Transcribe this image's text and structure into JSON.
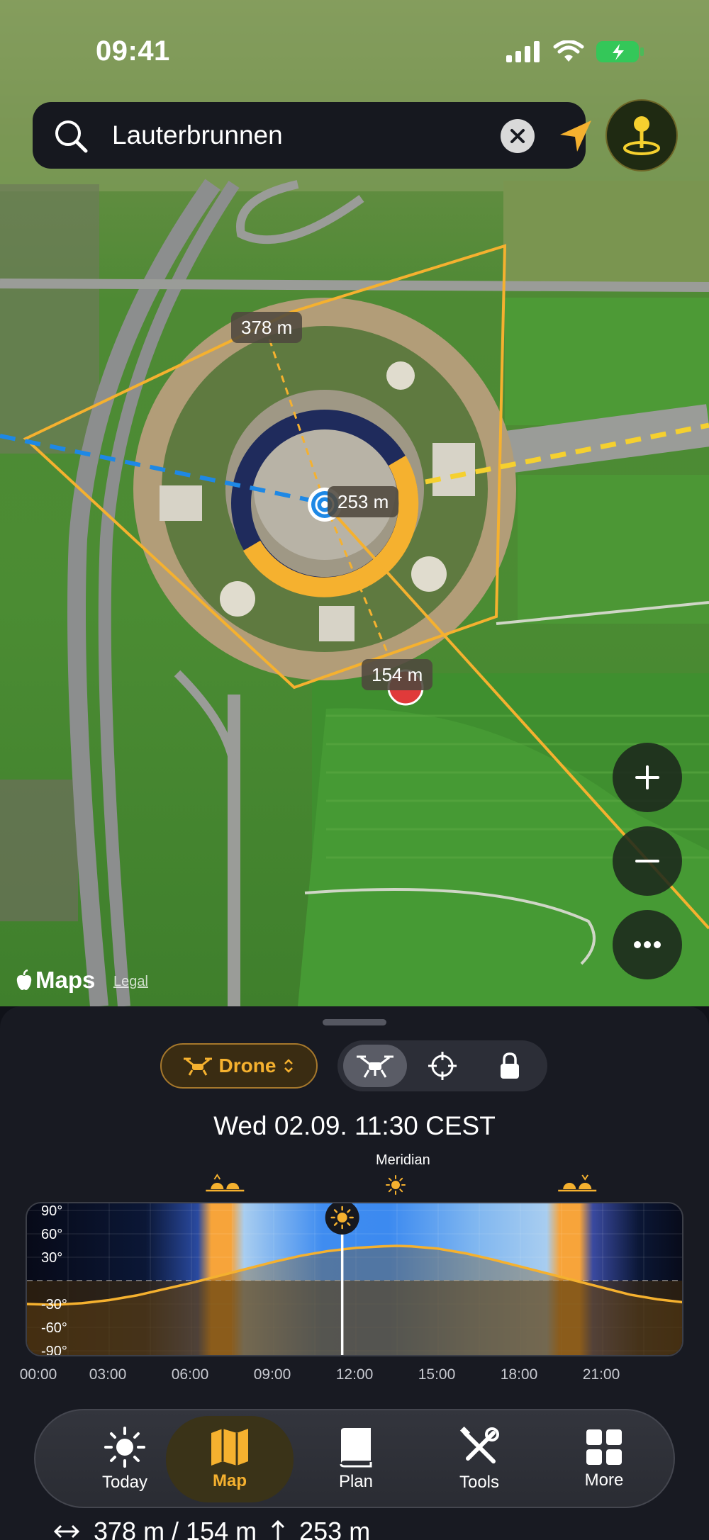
{
  "status_bar": {
    "time": "09:41",
    "icons": [
      "cellular-signal-icon",
      "wifi-icon",
      "battery-charging-icon"
    ]
  },
  "search": {
    "value": "Lauterbrunnen",
    "placeholder": "Search"
  },
  "map": {
    "distance_labels": {
      "north": "378 m",
      "center": "253 m",
      "south": "154 m"
    },
    "attribution": {
      "brand": "Maps",
      "legal": "Legal"
    },
    "colors": {
      "accent": "#F5B12F",
      "route_blue": "#1E88E5",
      "ring_dark": "#1F2B5C"
    }
  },
  "sheet": {
    "mode": {
      "label": "Drone",
      "icon": "drone-icon"
    },
    "segments": [
      {
        "name": "drone-icon",
        "active": true
      },
      {
        "name": "crosshair-icon",
        "active": false
      },
      {
        "name": "lock-icon",
        "active": false
      }
    ],
    "datetime": "Wed 02.09. 11:30  CEST",
    "meridian_label": "Meridian"
  },
  "chart_data": {
    "type": "line",
    "title": "",
    "xlabel": "",
    "ylabel": "",
    "x_ticks": [
      "00:00",
      "03:00",
      "06:00",
      "09:00",
      "12:00",
      "15:00",
      "18:00",
      "21:00"
    ],
    "y_ticks": [
      "90°",
      "60°",
      "30°",
      "-30°",
      "-60°",
      "-90°"
    ],
    "xlim": [
      0,
      24
    ],
    "ylim": [
      -90,
      90
    ],
    "current_time": 11.5,
    "markers": [
      {
        "name": "sunrise-icon",
        "x": 7.25
      },
      {
        "name": "meridian-sun-icon",
        "x": 13.5
      },
      {
        "name": "sunset-icon",
        "x": 20.1
      }
    ],
    "series": [
      {
        "x": [
          0,
          1,
          2,
          3,
          4,
          5,
          6,
          7,
          8,
          9,
          10,
          11,
          12,
          13,
          13.5,
          14,
          15,
          16,
          17,
          18,
          19,
          20,
          21,
          22,
          23,
          24
        ],
        "y": [
          -30,
          -31,
          -29,
          -25,
          -19,
          -11,
          -3,
          6,
          15,
          24,
          32,
          38,
          42,
          44,
          44.5,
          44,
          41,
          35,
          27,
          18,
          9,
          0,
          -9,
          -18,
          -24,
          -28
        ]
      }
    ]
  },
  "tabbar": {
    "tabs": [
      {
        "label": "Today",
        "icon": "sun-icon",
        "active": false
      },
      {
        "label": "Map",
        "icon": "map-icon",
        "active": true
      },
      {
        "label": "Plan",
        "icon": "book-icon",
        "active": false
      },
      {
        "label": "Tools",
        "icon": "tools-icon",
        "active": false
      },
      {
        "label": "More",
        "icon": "grid-icon",
        "active": false
      }
    ]
  },
  "summary": {
    "horizontal": "378 m / 154 m",
    "vertical": "253 m"
  }
}
